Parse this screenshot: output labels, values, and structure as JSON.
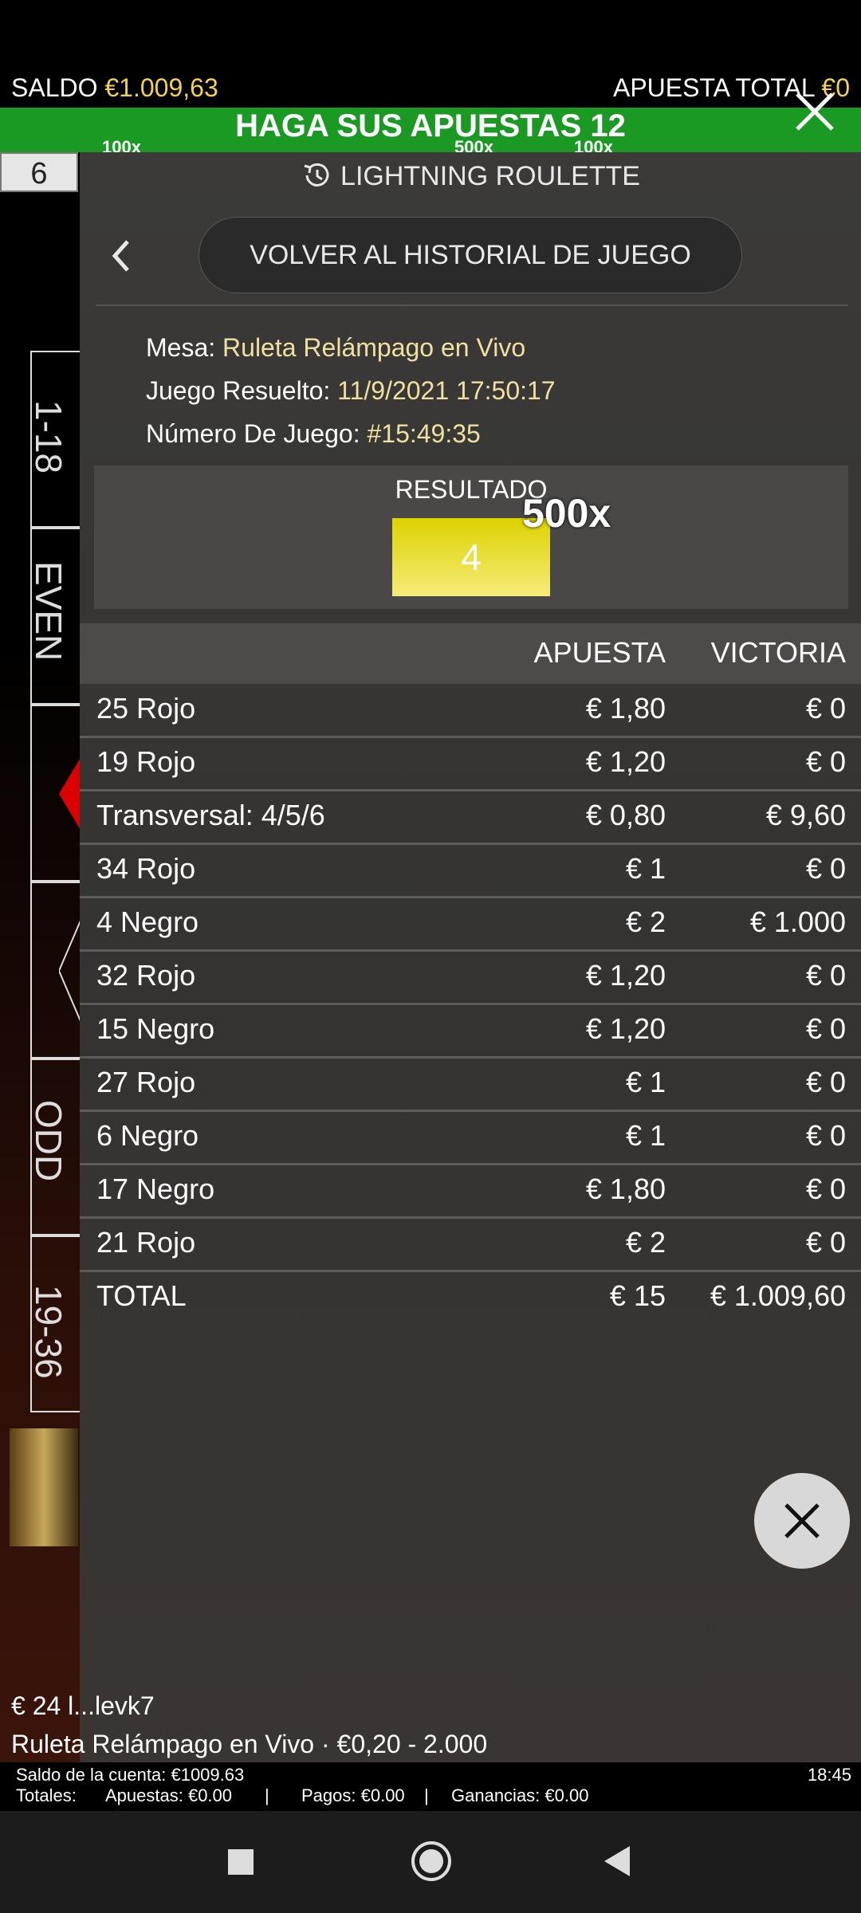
{
  "header": {
    "balance_label": "SALDO",
    "balance_value": "€1.009,63",
    "total_bet_label": "APUESTA TOTAL",
    "total_bet_value": "€0",
    "banner": "HAGA SUS APUESTAS 12",
    "multipliers": [
      "100x",
      "500x",
      "100x"
    ]
  },
  "left_board": {
    "last_number": "6",
    "labels": [
      "1-18",
      "EVEN",
      "ODD",
      "19-36"
    ]
  },
  "history_panel": {
    "game_title": "LIGHTNING ROULETTE",
    "back_button": "VOLVER AL HISTORIAL DE JUEGO",
    "table_label": "Mesa:",
    "table_value": "Ruleta Relámpago en Vivo",
    "resolved_label": "Juego Resuelto:",
    "resolved_value": "11/9/2021 17:50:17",
    "game_number_label": "Número De Juego:",
    "game_number_value": "#15:49:35",
    "result_label": "RESULTADO",
    "result_number": "4",
    "result_multiplier": "500x",
    "columns": [
      "APUESTA",
      "VICTORIA"
    ],
    "rows": [
      {
        "bet": "25 Rojo",
        "stake": "€ 1,80",
        "win": "€ 0"
      },
      {
        "bet": "19 Rojo",
        "stake": "€ 1,20",
        "win": "€ 0"
      },
      {
        "bet": "Transversal: 4/5/6",
        "stake": "€ 0,80",
        "win": "€ 9,60"
      },
      {
        "bet": "34 Rojo",
        "stake": "€ 1",
        "win": "€ 0"
      },
      {
        "bet": "4 Negro",
        "stake": "€ 2",
        "win": "€ 1.000"
      },
      {
        "bet": "32 Rojo",
        "stake": "€ 1,20",
        "win": "€ 0"
      },
      {
        "bet": "15 Negro",
        "stake": "€ 1,20",
        "win": "€ 0"
      },
      {
        "bet": "27 Rojo",
        "stake": "€ 1",
        "win": "€ 0"
      },
      {
        "bet": "6 Negro",
        "stake": "€ 1",
        "win": "€ 0"
      },
      {
        "bet": "17 Negro",
        "stake": "€ 1,80",
        "win": "€ 0"
      },
      {
        "bet": "21 Rojo",
        "stake": "€ 2",
        "win": "€ 0"
      }
    ],
    "total": {
      "bet": "TOTAL",
      "stake": "€ 15",
      "win": "€ 1.009,60"
    }
  },
  "footer": {
    "player_line": "€ 24 l...levk7",
    "table_line": "Ruleta Relámpago en Vivo · €0,20 - 2.000",
    "account_balance": "Saldo de la cuenta: €1009.63",
    "time": "18:45",
    "totals_label": "Totales:",
    "bets": "Apuestas: €0.00",
    "payouts": "Pagos: €0.00",
    "winnings": "Ganancias: €0.00"
  },
  "icons": [
    "close-icon",
    "history-clock-icon",
    "chevron-left-icon",
    "nav-stop-icon",
    "nav-home-icon",
    "nav-back-icon"
  ],
  "colors": {
    "accent_gold": "#f5d24a",
    "banner_green": "#1a9a23",
    "result_yellow": "#ddd200"
  }
}
